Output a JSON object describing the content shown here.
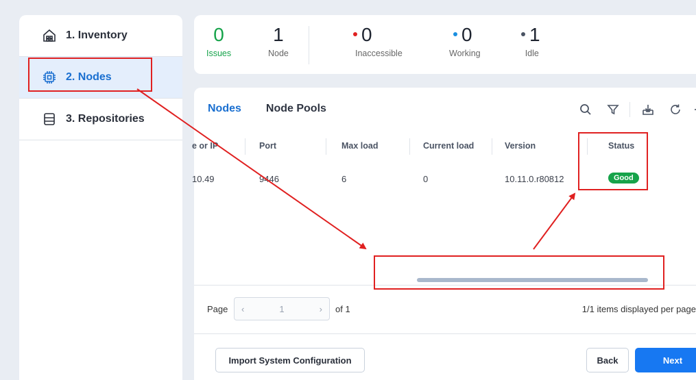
{
  "sidebar": {
    "items": [
      {
        "label": "1. Inventory",
        "icon": "inventory-icon"
      },
      {
        "label": "2. Nodes",
        "icon": "chip-icon",
        "active": true
      },
      {
        "label": "3. Repositories",
        "icon": "repository-icon"
      }
    ]
  },
  "stats": {
    "issues": {
      "value": "0",
      "label": "Issues",
      "color": "#16a34a"
    },
    "node": {
      "value": "1",
      "label": "Node"
    },
    "inaccessible": {
      "value": "0",
      "label": "Inaccessible",
      "dot_color": "#e02020"
    },
    "working": {
      "value": "0",
      "label": "Working",
      "dot_color": "#1a8fe0"
    },
    "idle": {
      "value": "1",
      "label": "Idle",
      "dot_color": "#4a5363"
    }
  },
  "tabs": [
    {
      "label": "Nodes",
      "active": true
    },
    {
      "label": "Node Pools"
    }
  ],
  "toolbar": {
    "icons": [
      "search-icon",
      "filter-icon",
      "export-icon",
      "refresh-icon"
    ]
  },
  "table": {
    "headers": {
      "host": "e or IP",
      "port": "Port",
      "max_load": "Max load",
      "current_load": "Current load",
      "version": "Version",
      "status": "Status"
    },
    "row": {
      "host": "10.49",
      "port": "9446",
      "max_load": "6",
      "current_load": "0",
      "version": "10.11.0.r80812",
      "status": "Good"
    }
  },
  "pager": {
    "page_label": "Page",
    "current_page": "1",
    "of_label": "of 1",
    "info": "1/1 items displayed per page"
  },
  "buttons": {
    "import": "Import System Configuration",
    "back": "Back",
    "next": "Next"
  },
  "colors": {
    "accent": "#1778f2",
    "annotation": "#e02020",
    "status_good": "#16a34a"
  }
}
